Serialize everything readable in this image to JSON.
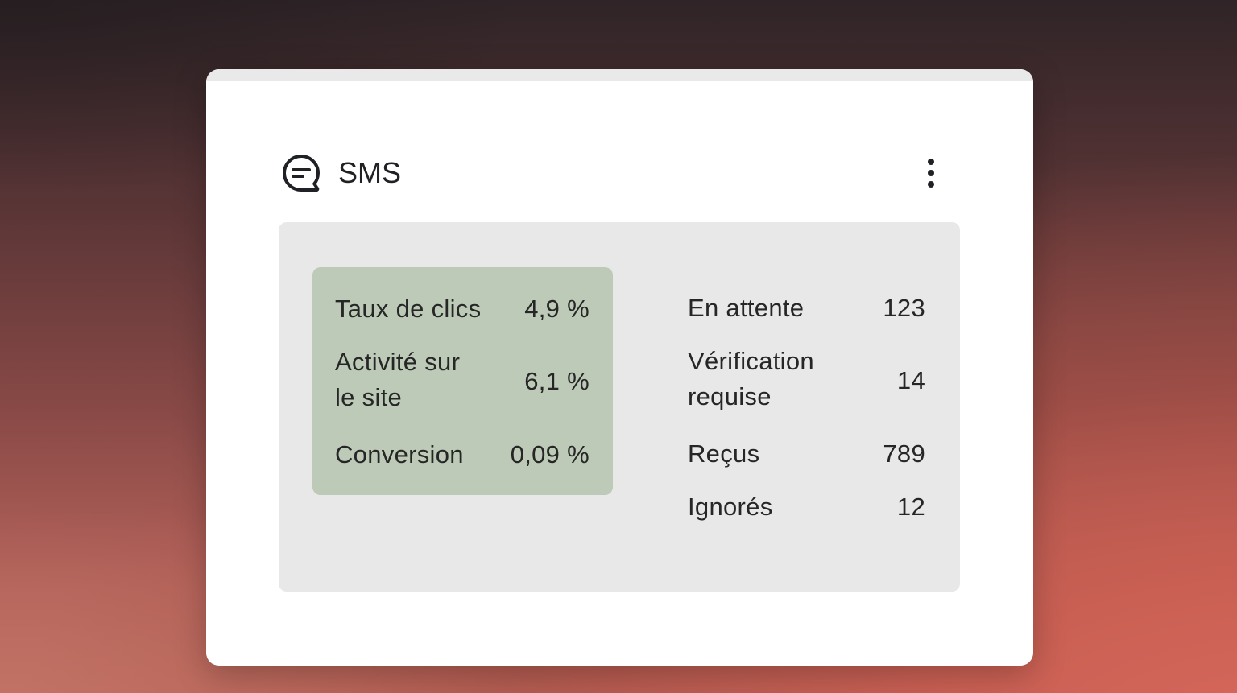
{
  "card": {
    "title": "SMS",
    "icon": "chat-bubble-icon",
    "menu_icon": "more-vertical-icon"
  },
  "highlighted_stats": [
    {
      "label": "Taux de clics",
      "value": "4,9 %"
    },
    {
      "label_line1": "Activité sur",
      "label_line2": "le site",
      "value": "6,1 %"
    },
    {
      "label": "Conversion",
      "value": "0,09 %"
    }
  ],
  "stats": [
    {
      "label": "En attente",
      "value": "123"
    },
    {
      "label_line1": "Vérification",
      "label_line2": "requise",
      "value": "14"
    },
    {
      "label": "Reçus",
      "value": "789"
    },
    {
      "label": "Ignorés",
      "value": "12"
    }
  ],
  "colors": {
    "highlight_bg": "#bccab7",
    "panel_bg": "#e8e8e8",
    "card_bg": "#ffffff",
    "text": "#262626"
  }
}
